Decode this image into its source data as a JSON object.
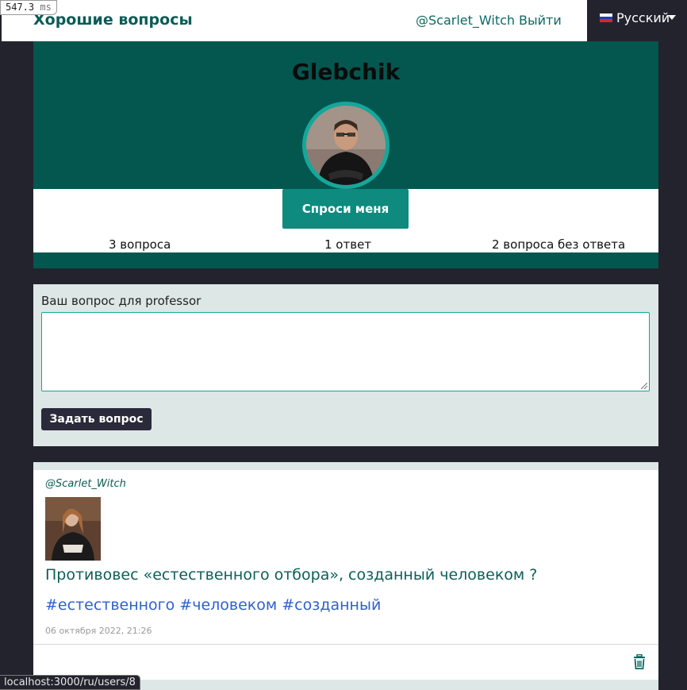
{
  "nav": {
    "brand": "Хорошие вопросы",
    "user": "@Scarlet_Witch",
    "logout": "Выйти",
    "language": "Русский"
  },
  "perf": {
    "value": "547.3",
    "unit": "ms"
  },
  "profile": {
    "name": "Glebchik",
    "ask_button": "Спроси меня",
    "stats": {
      "questions": "3 вопроса",
      "answers": "1 ответ",
      "unanswered": "2 вопроса без ответа"
    }
  },
  "form": {
    "label": "Ваш вопрос для professor",
    "value": "",
    "submit": "Задать вопрос"
  },
  "question": {
    "author": "@Scarlet_Witch",
    "text": "Противовес «естественного отбора», созданный человеком ?",
    "tags": [
      "#естественного",
      "#человеком",
      "#созданный"
    ],
    "date": "06 октября 2022, 21:26"
  },
  "status_url": "localhost:3000/ru/users/8",
  "colors": {
    "brand": "#0a5c56",
    "profile_bg": "#03574f",
    "ring": "#13a89a",
    "ask_button": "#0e8a7e",
    "tag": "#2f5fd0",
    "page_bg": "#23232e"
  }
}
